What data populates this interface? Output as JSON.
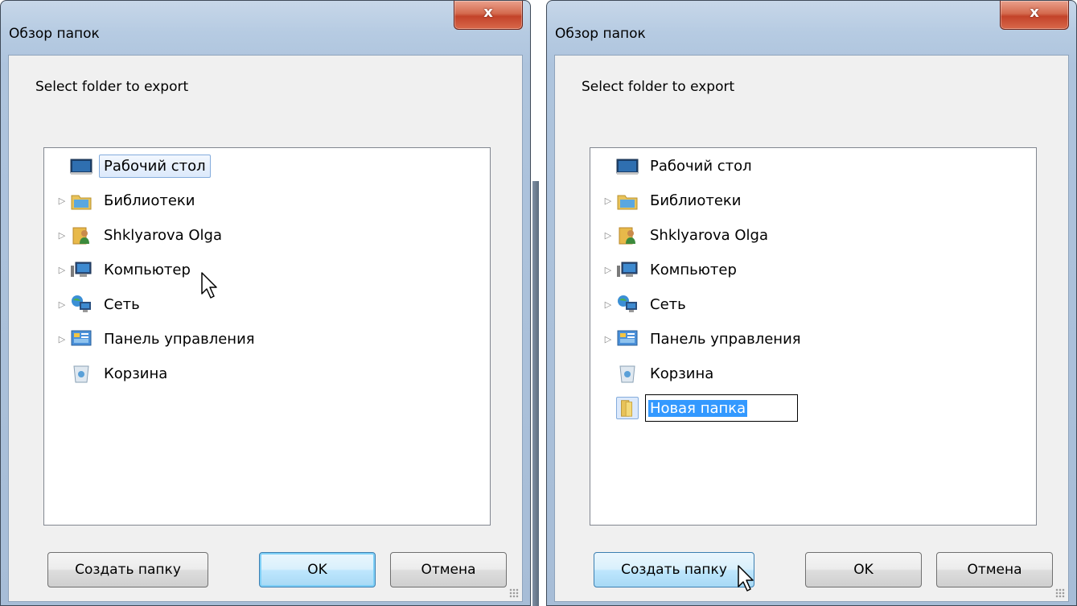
{
  "dialogs": [
    {
      "title": "Обзор папок",
      "close_label": "x",
      "prompt": "Select folder to export",
      "tree": [
        {
          "label": "Рабочий стол",
          "icon": "desktop-icon",
          "expander": false,
          "selected": true
        },
        {
          "label": "Библиотеки",
          "icon": "libraries-icon",
          "expander": true
        },
        {
          "label": "Shklyarova Olga",
          "icon": "user-folder-icon",
          "expander": true
        },
        {
          "label": "Компьютер",
          "icon": "computer-icon",
          "expander": true
        },
        {
          "label": "Сеть",
          "icon": "network-icon",
          "expander": true
        },
        {
          "label": "Панель управления",
          "icon": "control-panel-icon",
          "expander": true
        },
        {
          "label": "Корзина",
          "icon": "recycle-bin-icon",
          "expander": false
        }
      ],
      "buttons": {
        "new_folder": "Создать папку",
        "ok": "OK",
        "cancel": "Отмена"
      }
    },
    {
      "title": "Обзор папок",
      "close_label": "x",
      "prompt": "Select folder to export",
      "tree": [
        {
          "label": "Рабочий стол",
          "icon": "desktop-icon",
          "expander": false
        },
        {
          "label": "Библиотеки",
          "icon": "libraries-icon",
          "expander": true
        },
        {
          "label": "Shklyarova Olga",
          "icon": "user-folder-icon",
          "expander": true
        },
        {
          "label": "Компьютер",
          "icon": "computer-icon",
          "expander": true
        },
        {
          "label": "Сеть",
          "icon": "network-icon",
          "expander": true
        },
        {
          "label": "Панель управления",
          "icon": "control-panel-icon",
          "expander": true
        },
        {
          "label": "Корзина",
          "icon": "recycle-bin-icon",
          "expander": false
        }
      ],
      "new_folder_edit": "Новая папка",
      "buttons": {
        "new_folder": "Создать папку",
        "ok": "OK",
        "cancel": "Отмена"
      }
    }
  ],
  "colors": {
    "frame": "#b6cbe2",
    "close_button": "#c3432a",
    "selection": "#dce9fb",
    "edit_highlight": "#3399ff"
  }
}
